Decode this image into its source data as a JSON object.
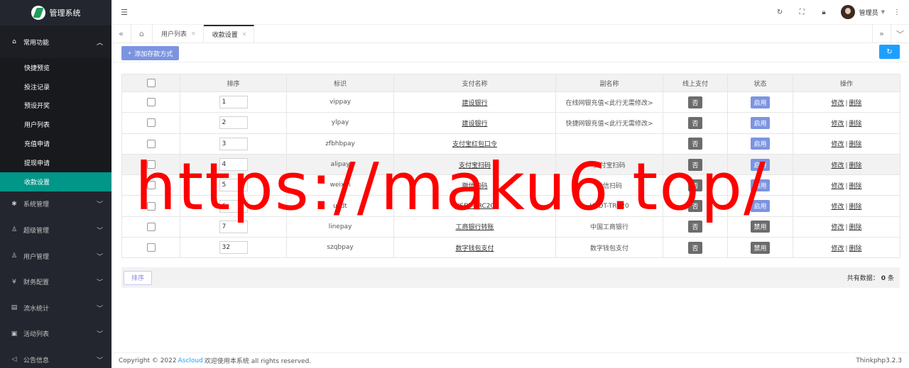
{
  "app": {
    "title": "管理系统"
  },
  "sidebar": {
    "top_group": {
      "label": "常用功能",
      "icon": "home-icon"
    },
    "sub_items": [
      {
        "label": "快捷预览"
      },
      {
        "label": "投注记录"
      },
      {
        "label": "预设开奖"
      },
      {
        "label": "用户列表"
      },
      {
        "label": "充值申请"
      },
      {
        "label": "提现申请"
      },
      {
        "label": "收款设置",
        "active": true
      }
    ],
    "groups": [
      {
        "label": "系统管理",
        "icon": "gear-icon"
      },
      {
        "label": "超级管理",
        "icon": "user-icon"
      },
      {
        "label": "用户管理",
        "icon": "users-icon"
      },
      {
        "label": "财务配置",
        "icon": "money-icon"
      },
      {
        "label": "流水统计",
        "icon": "chart-icon"
      },
      {
        "label": "活动列表",
        "icon": "gift-icon"
      },
      {
        "label": "公告信息",
        "icon": "speaker-icon"
      }
    ]
  },
  "header": {
    "admin_name": "管理员"
  },
  "tabs": [
    {
      "label": "用户列表",
      "active": false
    },
    {
      "label": "收款设置",
      "active": true
    }
  ],
  "toolbar": {
    "add_label": "添加存款方式"
  },
  "table": {
    "columns": [
      "排序",
      "标识",
      "支付名称",
      "副名称",
      "线上支付",
      "状态",
      "操作"
    ],
    "rows": [
      {
        "sort": "1",
        "id": "vippay",
        "name": "建设银行",
        "subname": "在线网银充值<此行无需修改>",
        "online": "否",
        "status": "启用",
        "status_on": true,
        "highlight": false
      },
      {
        "sort": "2",
        "id": "ylpay",
        "name": "建设银行",
        "subname": "快捷网银充值<此行无需修改>",
        "online": "否",
        "status": "启用",
        "status_on": true,
        "highlight": false
      },
      {
        "sort": "3",
        "id": "zfbhbpay",
        "name": "支付宝红包口令",
        "subname": "",
        "online": "否",
        "status": "启用",
        "status_on": true,
        "highlight": false
      },
      {
        "sort": "4",
        "id": "alipay",
        "name": "支付宝扫码",
        "subname": "支付宝扫码",
        "online": "否",
        "status": "启用",
        "status_on": true,
        "highlight": true
      },
      {
        "sort": "5",
        "id": "weixin",
        "name": "微信扫码",
        "subname": "微信扫码",
        "online": "否",
        "status": "启用",
        "status_on": true,
        "highlight": false
      },
      {
        "sort": "6",
        "id": "usdt",
        "name": "USDT-TRC20",
        "subname": "USDT-TRC20",
        "online": "否",
        "status": "启用",
        "status_on": true,
        "highlight": false
      },
      {
        "sort": "7",
        "id": "linepay",
        "name": "工商银行转账",
        "subname": "中国工商银行",
        "online": "否",
        "status": "禁用",
        "status_on": false,
        "highlight": false
      },
      {
        "sort": "32",
        "id": "szqbpay",
        "name": "数字钱包支付",
        "subname": "数字钱包支付",
        "online": "否",
        "status": "禁用",
        "status_on": false,
        "highlight": false
      }
    ],
    "edit_label": "修改",
    "delete_label": "删除",
    "separator": "|"
  },
  "footer_bar": {
    "sort_button": "排序",
    "total_label": "共有数据：",
    "total_count": "0",
    "total_unit": "条"
  },
  "page_footer": {
    "copyright_prefix": "Copyright © 2022",
    "brand": "Ascloud",
    "copyright_suffix": "欢迎使用本系统 all rights reserved.",
    "version": "Thinkphp3.2.3"
  },
  "watermark": "https://maku6.top/"
}
